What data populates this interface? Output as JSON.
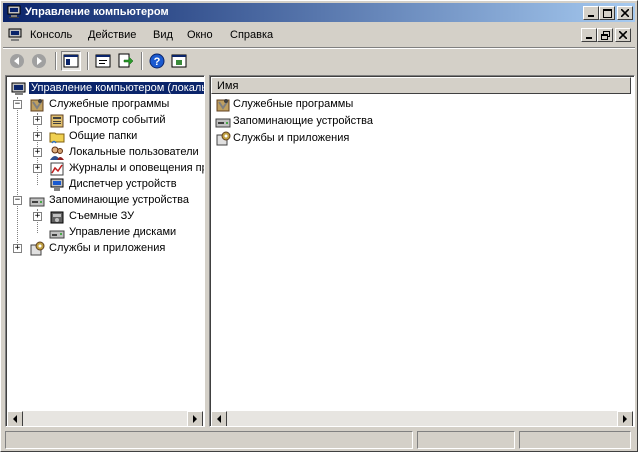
{
  "window": {
    "title": "Управление компьютером"
  },
  "menubar": {
    "items": [
      "Консоль",
      "Действие",
      "Вид",
      "Окно",
      "Справка"
    ]
  },
  "toolbar": {
    "buttons": [
      "back-icon",
      "forward-icon",
      "show-hide-tree-icon",
      "properties-icon",
      "export-list-icon",
      "help-icon",
      "new-window-icon"
    ]
  },
  "tree": {
    "root": "Управление компьютером (локаль",
    "groups": [
      {
        "label": "Служебные программы",
        "items": [
          "Просмотр событий",
          "Общие папки",
          "Локальные пользователи",
          "Журналы и оповещения пр",
          "Диспетчер устройств"
        ]
      },
      {
        "label": "Запоминающие устройства",
        "items": [
          "Съемные ЗУ",
          "Управление дисками"
        ]
      },
      {
        "label": "Службы и приложения",
        "items": []
      }
    ]
  },
  "list": {
    "column_header": "Имя",
    "rows": [
      "Служебные программы",
      "Запоминающие устройства",
      "Службы и приложения"
    ]
  },
  "colors": {
    "title_start": "#0a246a",
    "title_end": "#a6caf0",
    "selection": "#0a246a",
    "face": "#d4d0c8"
  }
}
